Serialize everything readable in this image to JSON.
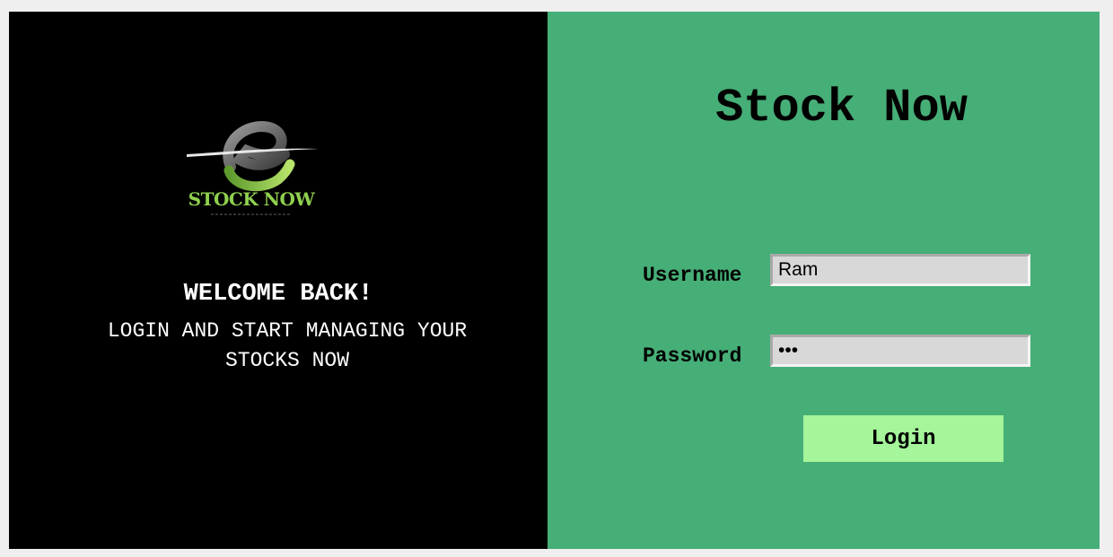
{
  "brand": {
    "logo_text": "STOCK NOW",
    "logo_icon": "stock-now-logo",
    "colors": {
      "left_background": "#000000",
      "right_background": "#46ae77",
      "logo_green": "#8fd14f",
      "login_button": "#a5f59a"
    }
  },
  "welcome": {
    "title": "WELCOME BACK!",
    "subtitle": "LOGIN AND START MANAGING YOUR STOCKS NOW"
  },
  "form": {
    "app_title": "Stock Now",
    "username_label": "Username",
    "username_value": "Ram",
    "password_label": "Password",
    "password_value": "•••",
    "login_label": "Login"
  }
}
